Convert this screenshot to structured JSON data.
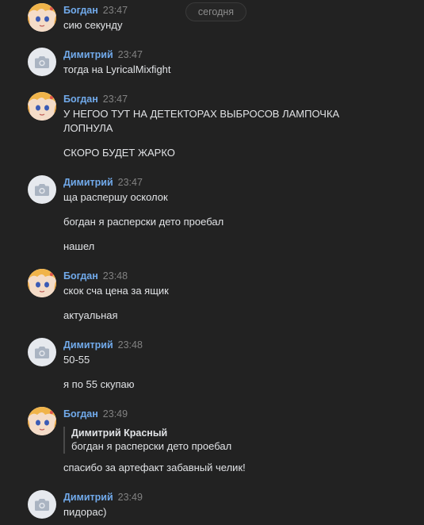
{
  "date_divider": "сегодня",
  "messages": [
    {
      "author": "Богдан",
      "time": "23:47",
      "lines": [
        "сию секунду"
      ]
    },
    {
      "author": "Димитрий",
      "time": "23:47",
      "lines": [
        "тогда на LyricalMixfight"
      ]
    },
    {
      "author": "Богдан",
      "time": "23:47",
      "lines": [
        "У НЕГОО ТУТ НА ДЕТЕКТОРАХ ВЫБРОСОВ ЛАМПОЧКА",
        "ЛОПНУЛА",
        "СКОРО БУДЕТ ЖАРКО"
      ]
    },
    {
      "author": "Димитрий",
      "time": "23:47",
      "lines": [
        "ща распершу осколок",
        "богдан я расперски дето проебал",
        "нашел"
      ]
    },
    {
      "author": "Богдан",
      "time": "23:48",
      "lines": [
        "скок сча цена за ящик",
        "актуальная"
      ]
    },
    {
      "author": "Димитрий",
      "time": "23:48",
      "lines": [
        "50-55",
        "я по 55 скупаю"
      ]
    },
    {
      "author": "Богдан",
      "time": "23:49",
      "quote": {
        "author": "Димитрий Красный",
        "text": "богдан я расперски дето проебал"
      },
      "lines": [
        "спасибо за артефакт забавный челик!"
      ]
    },
    {
      "author": "Димитрий",
      "time": "23:49",
      "lines": [
        "пидорас)"
      ]
    }
  ],
  "avatar_icons": {
    "bogdan": "anime-girl-avatar-icon",
    "dimitriy": "camera-placeholder-icon"
  },
  "colors": {
    "background": "#222222",
    "author": "#71aaeb",
    "time": "#828282",
    "text": "#e1e3e6"
  }
}
